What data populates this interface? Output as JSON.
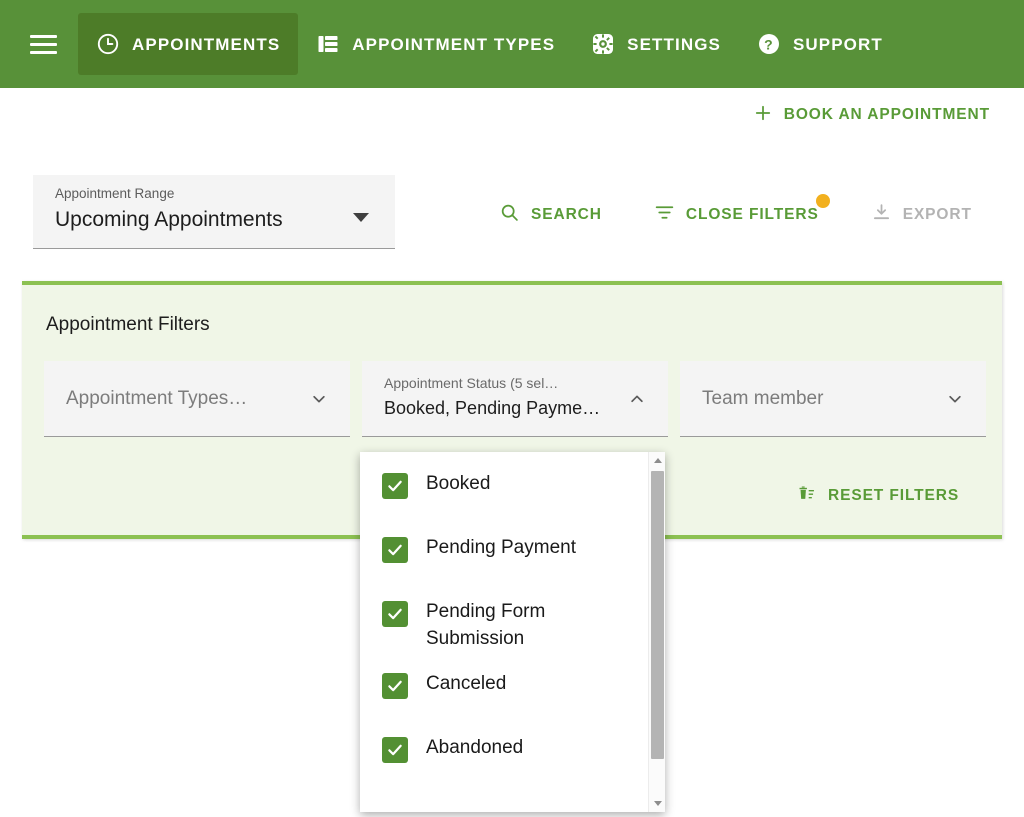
{
  "topbar": {
    "menu_icon": "hamburger-icon",
    "tabs": [
      {
        "label": "APPOINTMENTS",
        "icon": "clock-icon",
        "active": true
      },
      {
        "label": "APPOINTMENT TYPES",
        "icon": "list-icon",
        "active": false
      },
      {
        "label": "SETTINGS",
        "icon": "gear-icon",
        "active": false
      },
      {
        "label": "SUPPORT",
        "icon": "help-circle-icon",
        "active": false
      }
    ],
    "bg_color": "#589139",
    "active_bg_color": "#4d7c28"
  },
  "actions": {
    "book_appointment": "BOOK AN APPOINTMENT",
    "book_icon": "plus-icon",
    "search": "SEARCH",
    "search_icon": "search-icon",
    "close_filters": "CLOSE FILTERS",
    "filter_icon": "filter-icon",
    "filters_badge": "",
    "export": "EXPORT",
    "export_icon": "download-icon",
    "export_disabled": true,
    "accent_color": "#599b37",
    "badge_color": "#f2b01e",
    "disabled_color": "#b3b3b3"
  },
  "range_select": {
    "label": "Appointment Range",
    "value": "Upcoming Appointments",
    "icon": "caret-down-icon"
  },
  "filters_panel": {
    "title": "Appointment Filters",
    "bg_color": "#f0f6e7",
    "border_color": "#8cc152",
    "fields": [
      {
        "name": "appointment-types",
        "placeholder": "Appointment Types…",
        "label": "",
        "value": "",
        "icon": "chevron-down-icon",
        "expanded": false
      },
      {
        "name": "appointment-status",
        "placeholder": "",
        "label": "Appointment Status (5 sel…",
        "value": "Booked, Pending Payme…",
        "icon": "chevron-up-icon",
        "expanded": true
      },
      {
        "name": "team-member",
        "placeholder": "Team member",
        "label": "",
        "value": "",
        "icon": "chevron-down-icon",
        "expanded": false
      }
    ],
    "reset_label": "RESET FILTERS",
    "reset_icon": "delete-sweep-icon"
  },
  "status_dropdown": {
    "checkbox_color": "#539033",
    "options": [
      {
        "label": "Booked",
        "checked": true
      },
      {
        "label": "Pending Payment",
        "checked": true
      },
      {
        "label": "Pending Form Submission",
        "checked": true
      },
      {
        "label": "Canceled",
        "checked": true
      },
      {
        "label": "Abandoned",
        "checked": true
      }
    ],
    "scrollbar": {
      "up_icon": "scroll-up-arrow-icon",
      "down_icon": "scroll-down-arrow-icon"
    }
  }
}
